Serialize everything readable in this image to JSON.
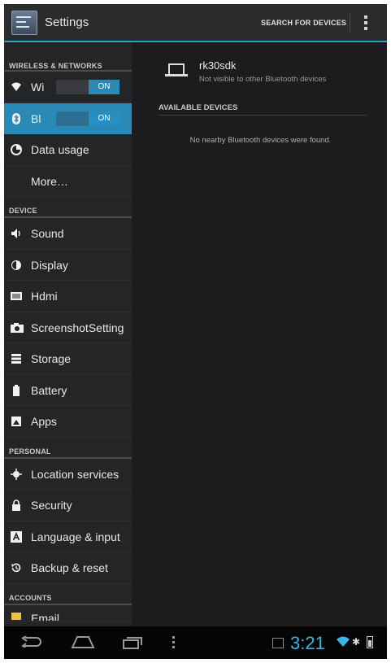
{
  "action_bar": {
    "title": "Settings",
    "search_label": "SEARCH FOR DEVICES",
    "icon": "settings-sliders-icon",
    "overflow_icon": "overflow-menu-icon"
  },
  "sidebar": {
    "sections": {
      "wireless": "WIRELESS & NETWORKS",
      "device": "DEVICE",
      "personal": "PERSONAL",
      "accounts": "ACCOUNTS"
    },
    "items": [
      {
        "label": "Wi",
        "icon": "wifi-icon",
        "toggle": "ON"
      },
      {
        "label": "Bl",
        "icon": "bluetooth-icon",
        "toggle": "ON",
        "selected": true
      },
      {
        "label": "Data usage",
        "icon": "data-usage-icon"
      },
      {
        "label": "More…",
        "icon": ""
      },
      {
        "label": "Sound",
        "icon": "speaker-icon"
      },
      {
        "label": "Display",
        "icon": "display-icon"
      },
      {
        "label": "Hdmi",
        "icon": "hdmi-icon"
      },
      {
        "label": "ScreenshotSetting",
        "icon": "camera-icon"
      },
      {
        "label": "Storage",
        "icon": "storage-icon"
      },
      {
        "label": "Battery",
        "icon": "battery-icon"
      },
      {
        "label": "Apps",
        "icon": "apps-icon"
      },
      {
        "label": "Location services",
        "icon": "location-icon"
      },
      {
        "label": "Security",
        "icon": "lock-icon"
      },
      {
        "label": "Language & input",
        "icon": "keyboard-icon"
      },
      {
        "label": "Backup & reset",
        "icon": "backup-icon"
      },
      {
        "label": "Email",
        "icon": "email-icon"
      }
    ]
  },
  "bluetooth": {
    "device_name": "rk30sdk",
    "device_status": "Not visible to other Bluetooth devices",
    "available_header": "AVAILABLE DEVICES",
    "empty_message": "No nearby Bluetooth devices were found."
  },
  "status_bar": {
    "time": "3:21"
  },
  "colors": {
    "accent": "#2b8ab5",
    "clock": "#39b6e8",
    "background": "#1c1c1e"
  }
}
